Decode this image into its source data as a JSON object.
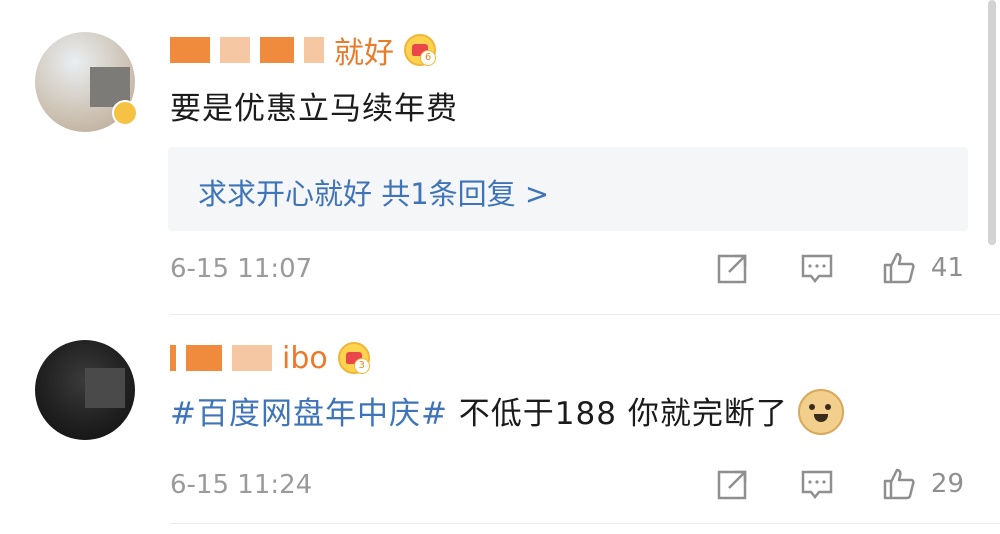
{
  "comments": [
    {
      "username_visible": "就好",
      "level": "6",
      "text": "要是优惠立马续年费",
      "reply_preview": "求求开心就好  共1条回复 >",
      "timestamp": "6-15 11:07",
      "like_count": "41"
    },
    {
      "username_visible": "ibo",
      "level": "3",
      "hashtag": "#百度网盘年中庆#",
      "text": " 不低于188 你就完断了",
      "timestamp": "6-15 11:24",
      "like_count": "29"
    }
  ],
  "colors": {
    "link_blue": "#3f74b8",
    "username_orange": "#ea7b2a",
    "meta_gray": "#9a9a9a",
    "reply_bg": "#f5f6f8"
  },
  "icons": {
    "share": "share-icon",
    "comment": "comment-icon",
    "like": "thumbs-up-icon",
    "crown": "crown-badge-icon",
    "emoji": "doge-emoji-icon"
  }
}
